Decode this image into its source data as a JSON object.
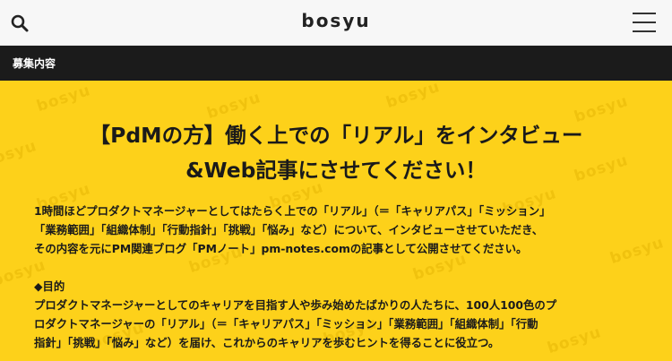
{
  "header": {
    "logo": "bosyu",
    "search_icon": "search-icon",
    "menu_icon": "hamburger-menu-icon"
  },
  "section_bar": {
    "label": "募集内容"
  },
  "content": {
    "background_color": "#fdd11a",
    "watermark_text": "bosyu",
    "title_line1": "【PdMの方】働く上での「リアル」をインタビュー",
    "title_line2": "&Web記事にさせてください！",
    "intro_line1": "1時間ほどプロダクトマネージャーとしてはたらく上での「リアル」（＝「キャリアパス」「ミッション」",
    "intro_line2": "「業務範囲」「組織体制」「行動指針」「挑戦」「悩み」など）について、インタビューさせていただき、",
    "intro_line3": "その内容を元にPM関連ブログ「PMノート」pm-notes.comの記事として公開させてください。",
    "goal_heading": "◆目的",
    "goal_line1": "プロダクトマネージャーとしてのキャリアを目指す人や歩み始めたばかりの人たちに、100人100色のプ",
    "goal_line2": "ロダクトマネージャーの「リアル」（＝「キャリアパス」「ミッション」「業務範囲」「組織体制」「行動",
    "goal_line3": "指針」「挑戦」「悩み」など）を届け、これからのキャリアを歩むヒントを得ることに役立つ。"
  }
}
